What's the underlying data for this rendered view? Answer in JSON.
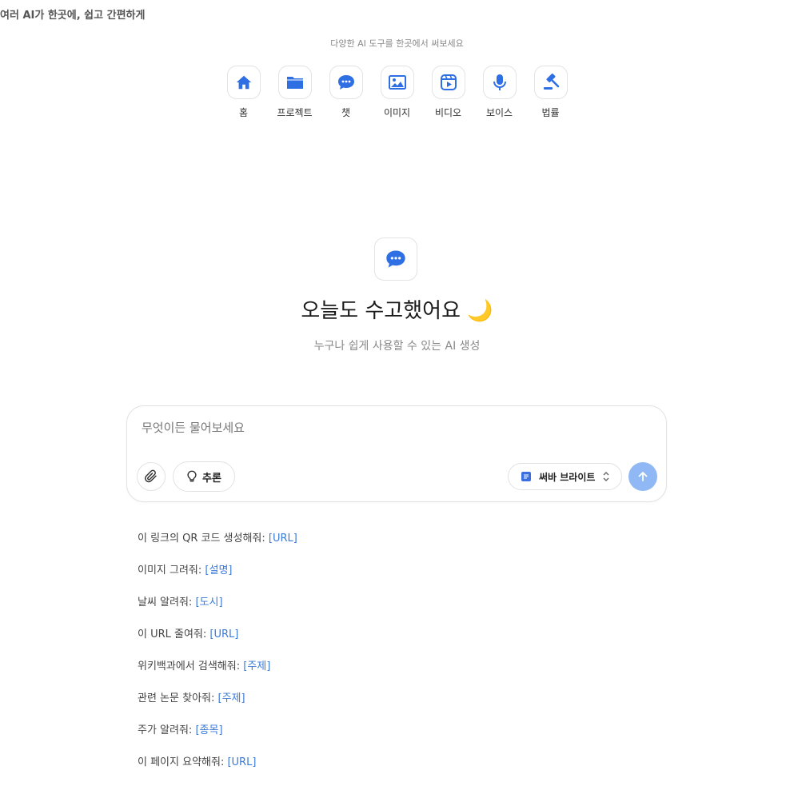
{
  "header": {
    "tagline": "여러 AI가 한곳에, 쉽고 간편하게"
  },
  "tools": {
    "caption": "다양한 AI 도구를 한곳에서 써보세요",
    "items": [
      {
        "label": "홈",
        "icon": "home-icon"
      },
      {
        "label": "프로젝트",
        "icon": "folder-icon"
      },
      {
        "label": "챗",
        "icon": "chat-icon"
      },
      {
        "label": "이미지",
        "icon": "image-icon"
      },
      {
        "label": "비디오",
        "icon": "video-icon"
      },
      {
        "label": "보이스",
        "icon": "microphone-icon"
      },
      {
        "label": "법률",
        "icon": "gavel-icon"
      }
    ]
  },
  "hero": {
    "icon": "chat-icon",
    "title": "오늘도 수고했어요 🌙",
    "subtitle": "누구나 쉽게 사용할 수 있는 AI 생성"
  },
  "composer": {
    "placeholder": "무엇이든 물어보세요",
    "value": "",
    "reason_label": "추론",
    "model_label": "써바 브라이트",
    "attach_icon": "paperclip-icon",
    "reason_icon": "lightbulb-icon",
    "send_icon": "arrow-up-icon"
  },
  "suggestions": [
    {
      "text": "이 링크의 QR 코드 생성해줘: ",
      "placeholder": "[URL]"
    },
    {
      "text": "이미지 그려줘: ",
      "placeholder": "[설명]"
    },
    {
      "text": "날씨 알려줘: ",
      "placeholder": "[도시]"
    },
    {
      "text": "이 URL 줄여줘: ",
      "placeholder": "[URL]"
    },
    {
      "text": "위키백과에서 검색해줘: ",
      "placeholder": "[주제]"
    },
    {
      "text": "관련 논문 찾아줘: ",
      "placeholder": "[주제]"
    },
    {
      "text": "주가 알려줘: ",
      "placeholder": "[종목]"
    },
    {
      "text": "이 페이지 요약해줘: ",
      "placeholder": "[URL]"
    }
  ],
  "colors": {
    "accent": "#2f6fe4",
    "send_disabled": "#8fb8f5",
    "link": "#3a7ad8"
  }
}
